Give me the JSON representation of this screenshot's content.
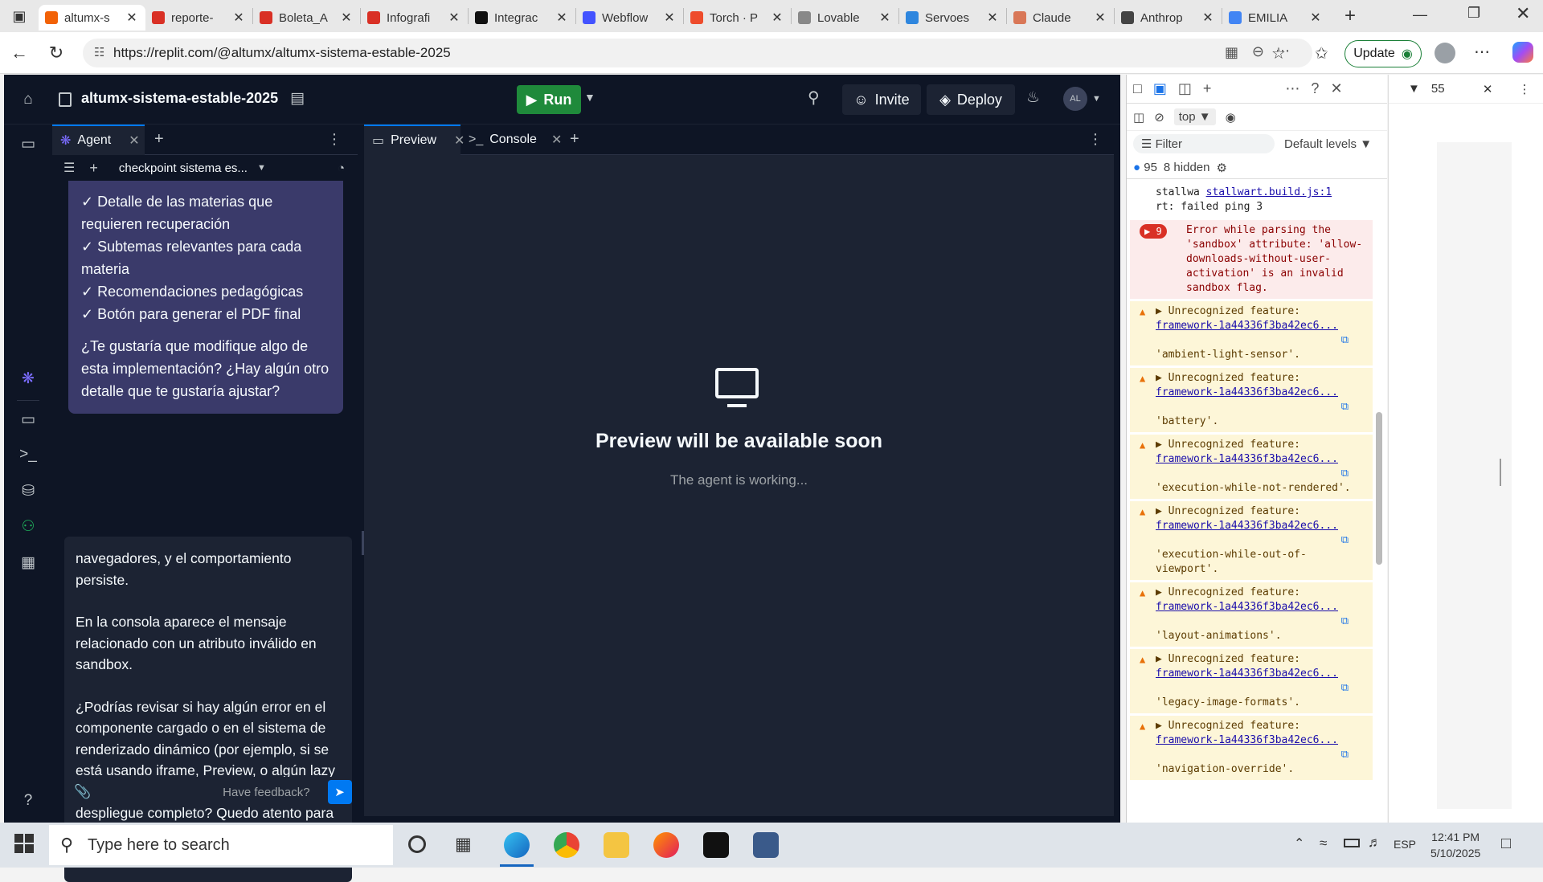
{
  "browser": {
    "tabs": [
      {
        "title": "altumx-s",
        "color": "#f26207",
        "active": true
      },
      {
        "title": "reporte-",
        "color": "#d93025"
      },
      {
        "title": "Boleta_A",
        "color": "#d93025"
      },
      {
        "title": "Infografi",
        "color": "#d93025"
      },
      {
        "title": "Integrac",
        "color": "#111111"
      },
      {
        "title": "Webflow",
        "color": "#4353ff"
      },
      {
        "title": "Torch · P",
        "color": "#ee4c2c"
      },
      {
        "title": "Lovable",
        "color": "#888888"
      },
      {
        "title": "Servoes",
        "color": "#2e86de"
      },
      {
        "title": "Claude",
        "color": "#d97757"
      },
      {
        "title": "Anthrop",
        "color": "#444444"
      },
      {
        "title": "EMILIA",
        "color": "#4285f4"
      }
    ],
    "url": "https://replit.com/@altumx/altumx-sistema-estable-2025",
    "update_label": "Update",
    "zoom_value": "55"
  },
  "replit": {
    "project_name": "altumx-sistema-estable-2025",
    "run_label": "Run",
    "invite_label": "Invite",
    "deploy_label": "Deploy",
    "avatar_initials": "AL",
    "agent_tab": "Agent",
    "checkpoint_label": "checkpoint sistema es...",
    "agent_message_lines": [
      "✓ Detalle de las materias que requieren recuperación",
      "✓ Subtemas relevantes para cada materia",
      "✓ Recomendaciones pedagógicas",
      "✓ Botón para generar el PDF final"
    ],
    "agent_question": "¿Te gustaría que modifique algo de esta implementación? ¿Hay algún otro detalle que te gustaría ajustar?",
    "input_para1": "navegadores, y el comportamiento persiste.",
    "input_para2": "En la consola aparece el mensaje relacionado con un atributo inválido en sandbox.",
    "input_para3": "¿Podrías revisar si hay algún error en el componente cargado o en el sistema de renderizado dinámico (por ejemplo, si se está usando iframe, Preview, o algún lazy loading) que esté bloqueando el despliegue completo? Quedo atento para validar en cuanto esté corregido. ¡Gracias!",
    "feedback_placeholder": "Have feedback?",
    "preview_tab": "Preview",
    "console_tab": "Console",
    "preview_title": "Preview will be available soon",
    "preview_subtitle": "The agent is working..."
  },
  "devtools": {
    "context": "top",
    "filter_placeholder": "Filter",
    "levels": "Default levels",
    "issue_count": "95",
    "hidden_count": "8 hidden",
    "top_line1": "stallwa ",
    "top_link": "stallwart.build.js:1",
    "top_line2": "rt: failed ping 3",
    "error_count": "9",
    "error_text": "Error while parsing the 'sandbox' attribute: 'allow-downloads-without-user-activation' is an invalid sandbox flag.",
    "warn_prefix": "Unrecognized feature:",
    "warn_link": "framework-1a44336f3ba42ec6...",
    "warnings": [
      "'ambient-light-sensor'.",
      "'battery'.",
      "'execution-while-not-rendered'.",
      "'execution-while-out-of-viewport'.",
      "'layout-animations'.",
      "'legacy-image-formats'.",
      "'navigation-override'."
    ]
  },
  "taskbar": {
    "search_placeholder": "Type here to search",
    "time": "12:41 PM",
    "date": "5/10/2025",
    "language": "ESP"
  }
}
